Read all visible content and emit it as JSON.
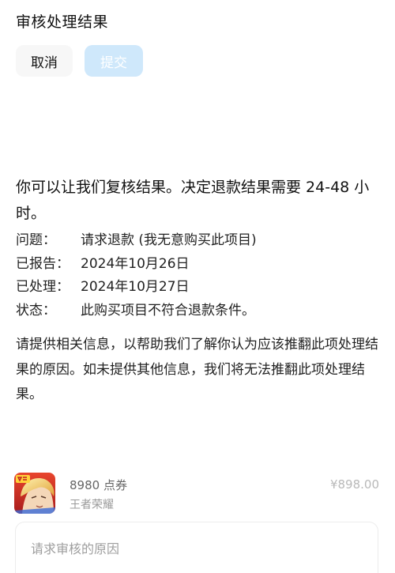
{
  "header": {
    "title": "审核处理结果",
    "cancel_label": "取消",
    "submit_label": "提交"
  },
  "main": {
    "heading": "你可以让我们复核结果。决定退款结果需要 24-48 小时。",
    "details": [
      {
        "label": "问题：",
        "value": "请求退款 (我无意购买此项目)"
      },
      {
        "label": "已报告：",
        "value": "2024年10月26日"
      },
      {
        "label": "已处理：",
        "value": "2024年10月27日"
      },
      {
        "label": "状态：",
        "value": "此购买项目不符合退款条件。"
      }
    ],
    "description": "请提供相关信息，以帮助我们了解你认为应该推翻此项处理结果的原因。如未提供其他信息，我们将无法推翻此项处理结果。"
  },
  "product": {
    "name": "8980 点券",
    "app": "王者荣耀",
    "price": "¥898.00",
    "icon": "game-app-icon"
  },
  "reason_input": {
    "value": "",
    "placeholder": "请求审核的原因"
  },
  "colors": {
    "submit_disabled_bg": "#cfe8fb",
    "cancel_bg": "#f7f7f7"
  }
}
